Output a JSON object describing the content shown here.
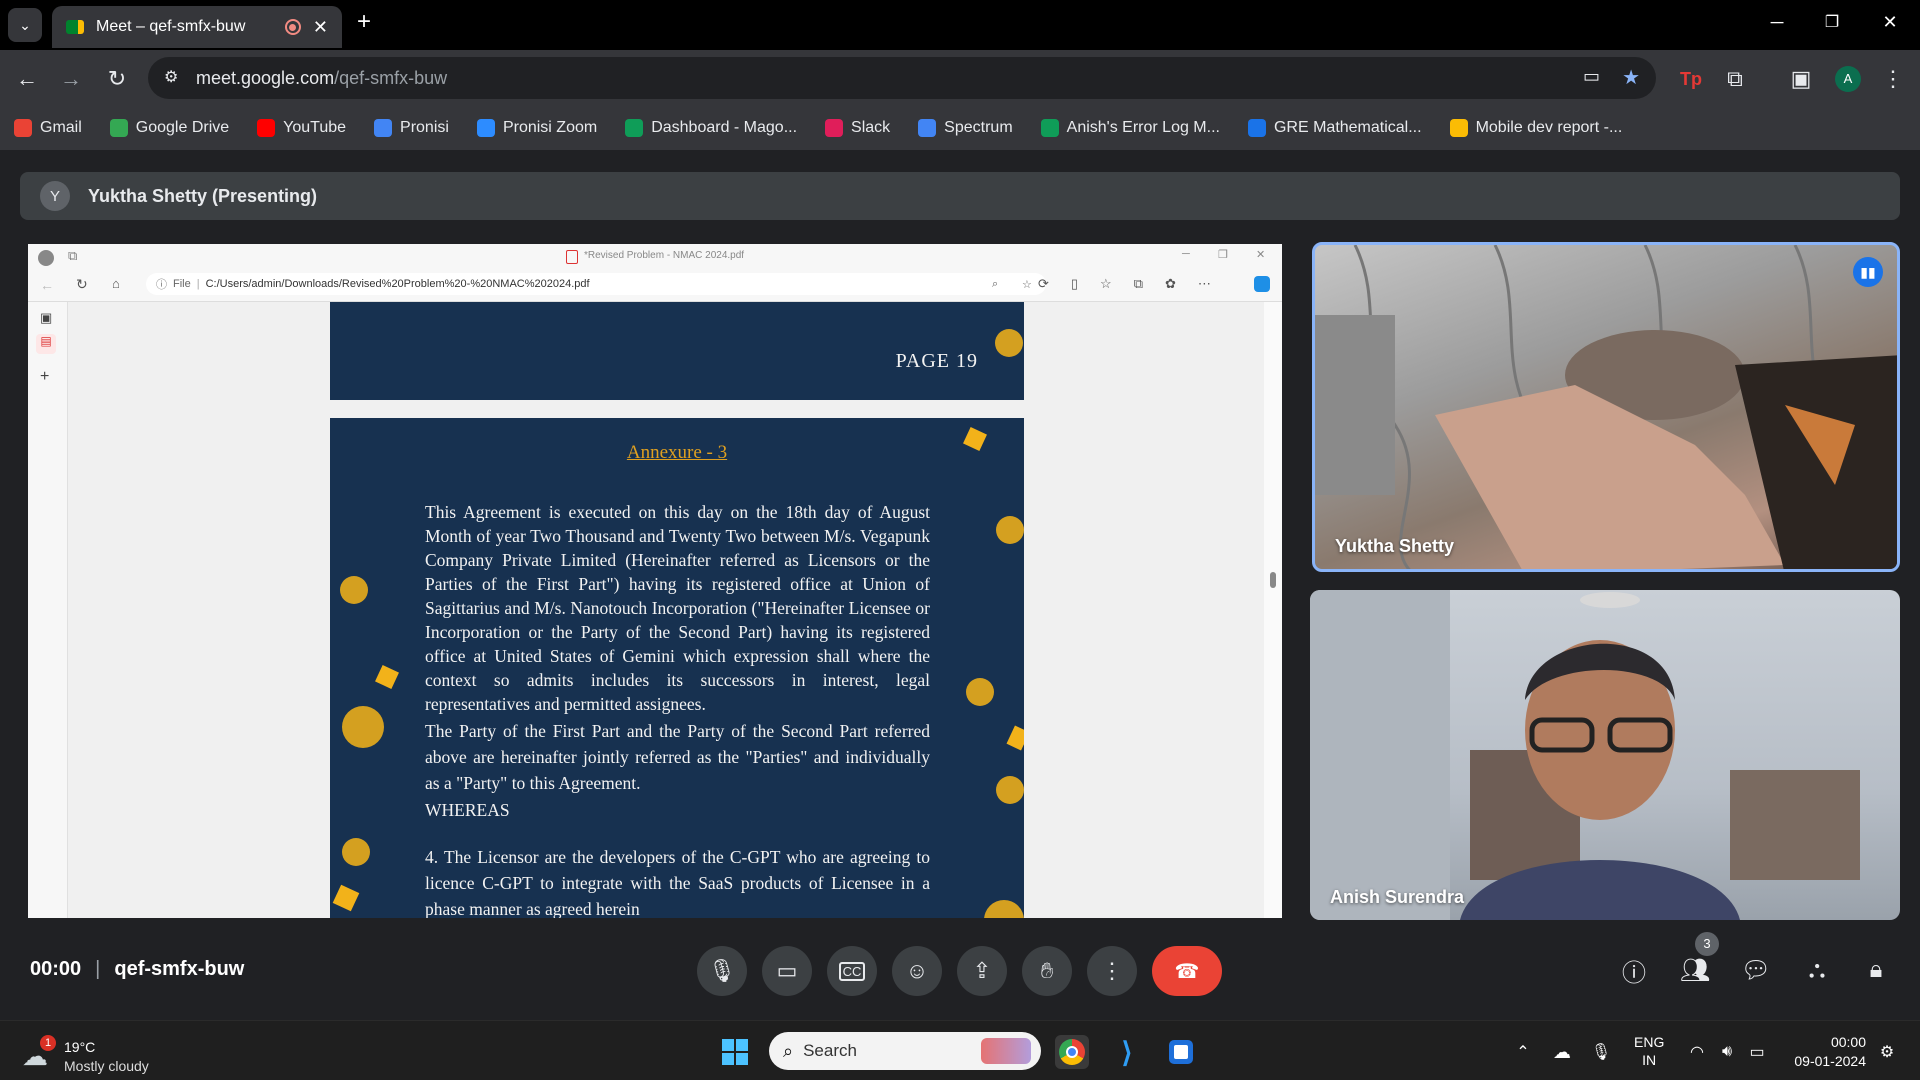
{
  "browser": {
    "tab_title": "Meet – qef-smfx-buw",
    "url_host": "meet.google.com",
    "url_path": "/qef-smfx-buw",
    "profile_initial": "A",
    "bookmarks": [
      {
        "label": "Gmail",
        "color": "#ea4335"
      },
      {
        "label": "Google Drive",
        "color": "#34a853"
      },
      {
        "label": "YouTube",
        "color": "#ff0000"
      },
      {
        "label": "Pronisi",
        "color": "#4285f4"
      },
      {
        "label": "Pronisi Zoom",
        "color": "#2d8cff"
      },
      {
        "label": "Dashboard - Mago...",
        "color": "#0f9d58"
      },
      {
        "label": "Slack",
        "color": "#e01e5a"
      },
      {
        "label": "Spectrum",
        "color": "#4285f4"
      },
      {
        "label": "Anish's Error Log M...",
        "color": "#0f9d58"
      },
      {
        "label": "GRE Mathematical...",
        "color": "#1a73e8"
      },
      {
        "label": "Mobile dev report -...",
        "color": "#fbbc04"
      }
    ]
  },
  "meet": {
    "presenter_initial": "Y",
    "presenter_label": "Yuktha Shetty (Presenting)",
    "time": "00:00",
    "meeting_code": "qef-smfx-buw",
    "people_count": "3",
    "participants": [
      {
        "name": "Yuktha Shetty"
      },
      {
        "name": "Anish Surendra"
      }
    ]
  },
  "shared": {
    "window_title": "*Revised Problem - NMAC 2024.pdf",
    "file_label": "File",
    "path": "C:/Users/admin/Downloads/Revised%20Problem%20-%20NMAC%202024.pdf",
    "page_label": "PAGE 19",
    "annexure": "Annexure - 3",
    "para1": "This Agreement is executed on this day on the 18th day of August Month of year Two Thousand and Twenty Two between M/s. Vegapunk Company Private Limited (Hereinafter referred as Licensors or the Parties of the First Part\") having its registered office at Union of Sagittarius and M/s. Nanotouch Incorporation (\"Hereinafter Licensee or Incorporation or the Party of the Second Part) having its registered office at United States of Gemini which expression shall where the context so admits includes its successors in interest, legal representatives and permitted assignees.",
    "para2": "The Party of the First Part and the Party of the Second Part referred above are hereinafter jointly referred as the \"Parties\" and individually as a \"Party\" to this Agreement.",
    "para3": "WHEREAS",
    "para4": "4. The Licensor are the developers of the C-GPT who are agreeing to licence C-GPT to integrate with the SaaS products of Licensee in a phase manner as agreed herein"
  },
  "taskbar": {
    "weather_badge": "1",
    "temperature": "19°C",
    "weather_text": "Mostly cloudy",
    "search_label": "Search",
    "lang_top": "ENG",
    "lang_bottom": "IN",
    "clock_time": "00:00",
    "clock_date": "09-01-2024"
  }
}
